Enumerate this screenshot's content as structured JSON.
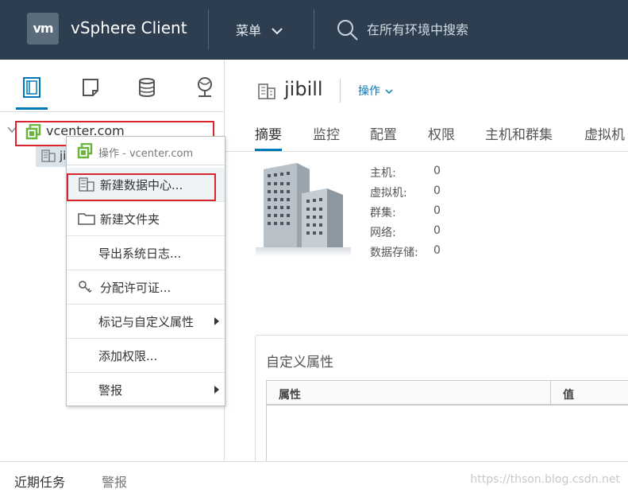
{
  "header": {
    "logo_text": "vm",
    "app_title": "vSphere Client",
    "menu_label": "菜单",
    "search_placeholder": "在所有环境中搜索"
  },
  "navigator": {
    "tabs": [
      "hosts-and-clusters-icon",
      "vms-and-templates-icon",
      "storage-icon",
      "networking-icon"
    ],
    "tree": {
      "root_label": "vcenter.com",
      "child_label": "ji"
    }
  },
  "context_menu": {
    "header_label": "操作 - vcenter.com",
    "items": [
      {
        "label": "新建数据中心...",
        "icon": "datacenter-icon",
        "submenu": false
      },
      {
        "label": "新建文件夹",
        "icon": "folder-icon",
        "submenu": false
      },
      {
        "label": "导出系统日志...",
        "icon": "",
        "submenu": false
      },
      {
        "label": "分配许可证...",
        "icon": "license-icon",
        "submenu": false
      },
      {
        "label": "标记与自定义属性",
        "icon": "",
        "submenu": true
      },
      {
        "label": "添加权限...",
        "icon": "",
        "submenu": false
      },
      {
        "label": "警报",
        "icon": "",
        "submenu": true
      }
    ]
  },
  "main": {
    "object_title": "jibill",
    "actions_label": "操作",
    "tabs": [
      "摘要",
      "监控",
      "配置",
      "权限",
      "主机和群集",
      "虚拟机"
    ],
    "active_tab": "摘要",
    "stats": [
      {
        "label": "主机:",
        "value": "0"
      },
      {
        "label": "虚拟机:",
        "value": "0"
      },
      {
        "label": "群集:",
        "value": "0"
      },
      {
        "label": "网络:",
        "value": "0"
      },
      {
        "label": "数据存储:",
        "value": "0"
      }
    ],
    "custom_attributes": {
      "title": "自定义属性",
      "columns": [
        "属性",
        "值"
      ]
    }
  },
  "bottom_bar": {
    "tabs": [
      "近期任务",
      "警报"
    ],
    "watermark": "https://thson.blog.csdn.net"
  },
  "colors": {
    "header_bg": "#2c3e50",
    "accent": "#0079b8",
    "highlight_box": "#d9252f",
    "vcenter_icon": "#6db33f"
  }
}
